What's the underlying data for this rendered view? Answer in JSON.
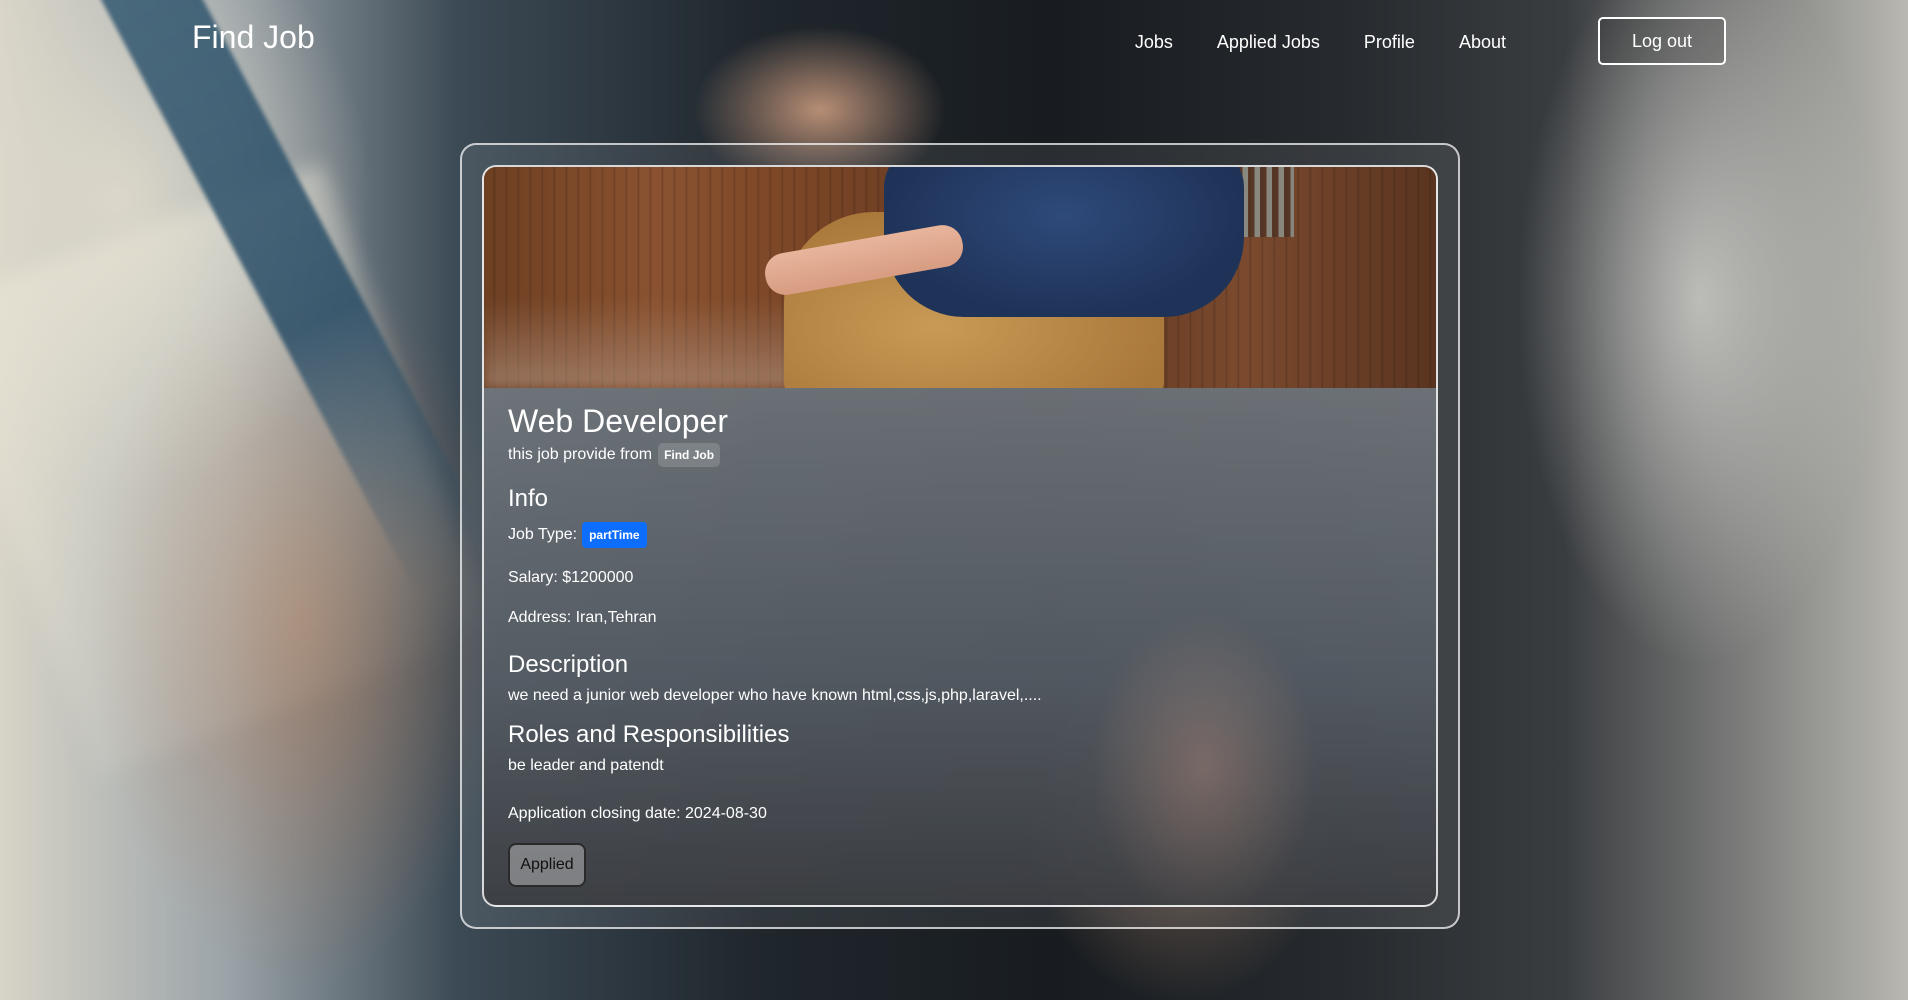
{
  "navbar": {
    "brand": "Find Job",
    "links": [
      "Jobs",
      "Applied Jobs",
      "Profile",
      "About"
    ],
    "logout_label": "Log out"
  },
  "job": {
    "title": "Web Developer",
    "provider_prefix": "this job provide from",
    "provider": "Find Job",
    "info_heading": "Info",
    "job_type_label": "Job Type:",
    "job_type": "partTime",
    "salary": "Salary: $1200000",
    "address": "Address: Iran,Tehran",
    "description_heading": "Description",
    "description": "we need a junior web developer who have known html,css,js,php,laravel,....",
    "roles_heading": "Roles and Responsibilities",
    "roles": "be leader and patendt",
    "closing_date": "Application closing date: 2024-08-30",
    "applied_label": "Applied"
  },
  "colors": {
    "job_type_badge": "#0d6efd",
    "text": "#ffffff"
  }
}
